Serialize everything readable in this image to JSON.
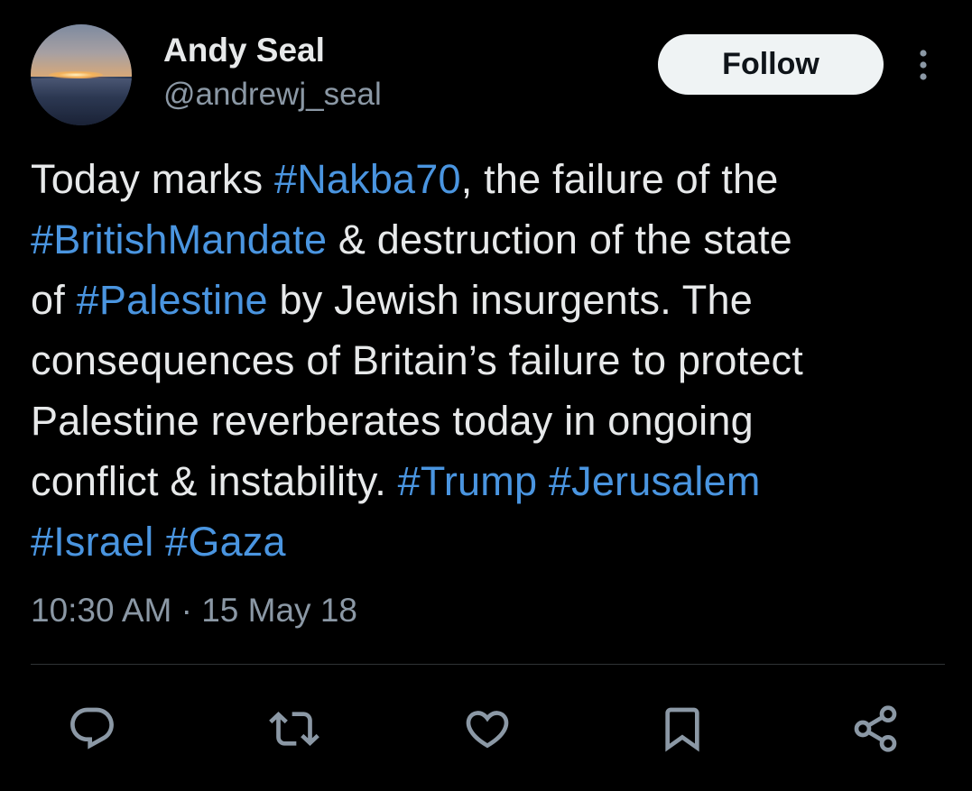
{
  "user": {
    "name": "Andy Seal",
    "handle": "@andrewj_seal"
  },
  "follow_label": "Follow",
  "tweet": {
    "lines": [
      [
        {
          "t": "Today marks "
        },
        {
          "t": "#Nakba70",
          "tag": true
        },
        {
          "t": ", the failure of the"
        }
      ],
      [
        {
          "t": "#BritishMandate",
          "tag": true
        },
        {
          "t": " & destruction of the state"
        }
      ],
      [
        {
          "t": "of "
        },
        {
          "t": "#Palestine",
          "tag": true
        },
        {
          "t": " by Jewish insurgents. The"
        }
      ],
      [
        {
          "t": "consequences of Britain’s failure to protect"
        }
      ],
      [
        {
          "t": "Palestine reverberates today in ongoing"
        }
      ],
      [
        {
          "t": "conflict & instability. "
        },
        {
          "t": "#Trump",
          "tag": true
        },
        {
          "t": " "
        },
        {
          "t": "#Jerusalem",
          "tag": true
        }
      ],
      [
        {
          "t": "#Israel",
          "tag": true
        },
        {
          "t": " "
        },
        {
          "t": "#Gaza",
          "tag": true
        }
      ]
    ]
  },
  "timestamp": "10:30 AM · 15 May 18",
  "actions": [
    "reply-icon",
    "retweet-icon",
    "like-icon",
    "bookmark-icon",
    "share-icon"
  ],
  "colors": {
    "background": "#000000",
    "text": "#e7e9ea",
    "secondary": "#8b98a5",
    "hashtag": "#4a95e0",
    "follow_bg": "#eff3f4"
  }
}
